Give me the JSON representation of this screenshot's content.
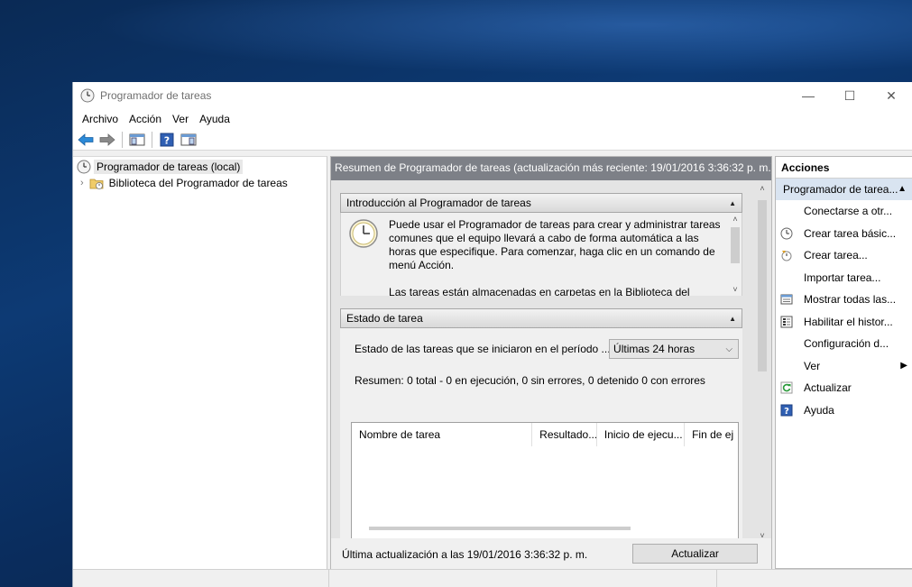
{
  "window": {
    "title": "Programador de tareas",
    "controls": {
      "minimize": "—",
      "maximize": "☐",
      "close": "✕"
    }
  },
  "menu": [
    "Archivo",
    "Acción",
    "Ver",
    "Ayuda"
  ],
  "toolbar": {
    "icons": [
      "back-icon",
      "forward-icon",
      "show-hide-console-tree-icon",
      "help-icon",
      "show-hide-action-pane-icon"
    ]
  },
  "tree": {
    "root": "Programador de tareas (local)",
    "child": "Biblioteca del Programador de tareas"
  },
  "middle": {
    "header": "Resumen de Programador de tareas (actualización más reciente: 19/01/2016 3:36:32 p. m.)",
    "intro": {
      "title": "Introducción al Programador de tareas",
      "paragraph1": "Puede usar el Programador de tareas para crear y administrar tareas comunes que el equipo llevará a cabo de forma automática a las horas que especifique. Para comenzar, haga clic en un comando de menú Acción.",
      "paragraph2": "Las tareas están almacenadas en carpetas en la Biblioteca del"
    },
    "estado": {
      "title": "Estado de tarea",
      "period_label": "Estado de las tareas que se iniciaron en el período ...",
      "period_value": "Últimas 24 horas",
      "summary": "Resumen: 0 total - 0 en ejecución, 0 sin errores, 0 detenido  0 con errores",
      "columns": [
        "Nombre de tarea",
        "Resultado...",
        "Inicio de ejecu...",
        "Fin de ej"
      ]
    },
    "footer": {
      "last_update": "Última actualización a las 19/01/2016 3:36:32 p. m.",
      "update_button": "Actualizar"
    }
  },
  "actions": {
    "header": "Acciones",
    "group": "Programador de tarea...",
    "items": [
      {
        "label": "Conectarse a otr...",
        "icon": ""
      },
      {
        "label": "Crear tarea básic...",
        "icon": "create-basic-task-icon"
      },
      {
        "label": "Crear tarea...",
        "icon": "create-task-icon"
      },
      {
        "label": "Importar tarea...",
        "icon": ""
      },
      {
        "label": "Mostrar todas las...",
        "icon": "show-running-tasks-icon"
      },
      {
        "label": "Habilitar el histor...",
        "icon": "enable-history-icon"
      },
      {
        "label": "Configuración d...",
        "icon": ""
      },
      {
        "label": "Ver",
        "icon": ""
      },
      {
        "label": "Actualizar",
        "icon": "refresh-icon"
      },
      {
        "label": "Ayuda",
        "icon": "help-icon"
      }
    ]
  }
}
